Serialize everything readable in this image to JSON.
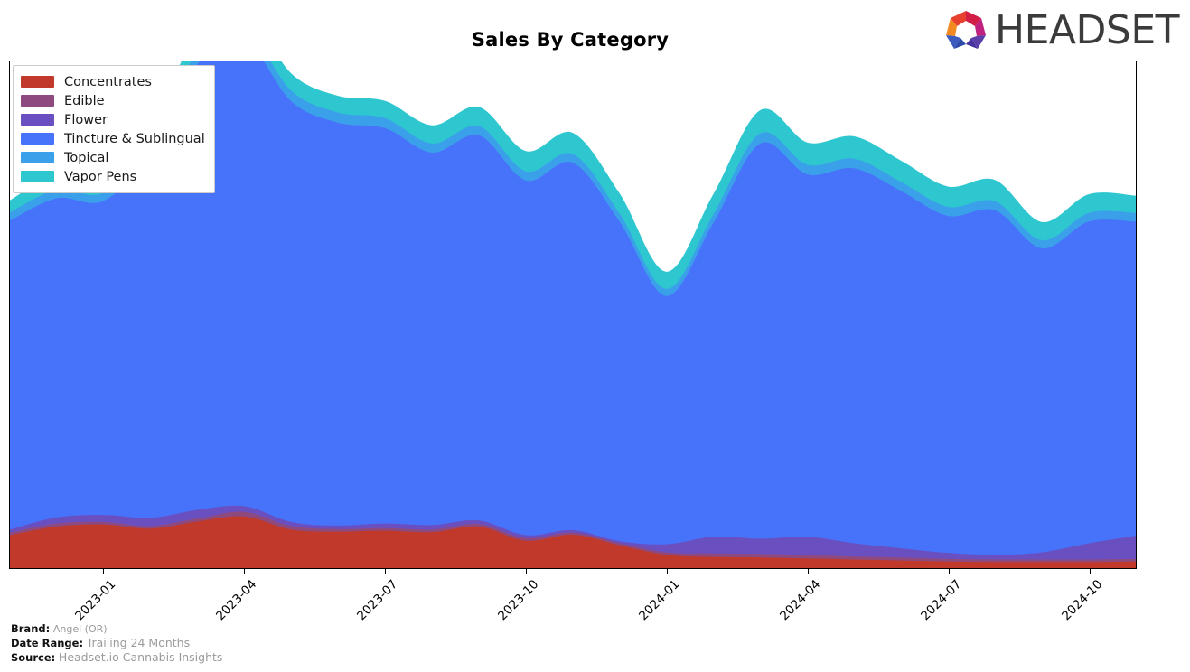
{
  "header": {
    "title": "Sales By Category",
    "logo_text": "HEADSET",
    "logo_icon": "headset-hexagon-logo"
  },
  "footer": {
    "brand_key": "Brand:",
    "brand_value": "Angel (OR)",
    "date_key": "Date Range:",
    "date_value": "Trailing 24 Months",
    "source_key": "Source:",
    "source_value": "Headset.io Cannabis Insights"
  },
  "legend": {
    "items": [
      {
        "label": "Concentrates",
        "color": "#c0392b"
      },
      {
        "label": "Edible",
        "color": "#8e4a7e"
      },
      {
        "label": "Flower",
        "color": "#6a4fc0"
      },
      {
        "label": "Tincture & Sublingual",
        "color": "#4772fa"
      },
      {
        "label": "Topical",
        "color": "#3aa0ea"
      },
      {
        "label": "Vapor Pens",
        "color": "#2ec7cf"
      }
    ]
  },
  "chart_data": {
    "type": "area",
    "stacked": true,
    "title": "Sales By Category",
    "xlabel": "",
    "ylabel": "",
    "grid": false,
    "legend_position": "upper-left",
    "axis_ticks_y_visible": false,
    "x": [
      "2022-11",
      "2022-12",
      "2023-01",
      "2023-02",
      "2023-03",
      "2023-04",
      "2023-05",
      "2023-06",
      "2023-07",
      "2023-08",
      "2023-09",
      "2023-10",
      "2023-11",
      "2023-12",
      "2024-01",
      "2024-02",
      "2024-03",
      "2024-04",
      "2024-05",
      "2024-06",
      "2024-07",
      "2024-08",
      "2024-09",
      "2024-10",
      "2024-11"
    ],
    "tick_labels": [
      "2023-01",
      "2023-04",
      "2023-07",
      "2023-10",
      "2024-01",
      "2024-04",
      "2024-07",
      "2024-10"
    ],
    "ylim": [
      0,
      100
    ],
    "series": [
      {
        "name": "Concentrates",
        "color": "#c0392b",
        "values": [
          6.5,
          8.2,
          8.6,
          7.8,
          9.2,
          10.2,
          7.6,
          7.2,
          7.4,
          7.1,
          8.2,
          5.4,
          6.6,
          4.5,
          2.6,
          2.2,
          2.1,
          1.9,
          1.7,
          1.5,
          1.3,
          1.2,
          1.2,
          1.2,
          1.3
        ]
      },
      {
        "name": "Edible",
        "color": "#8e4a7e",
        "values": [
          0.5,
          0.6,
          0.5,
          0.5,
          0.6,
          0.9,
          0.7,
          0.5,
          0.5,
          0.5,
          0.5,
          0.5,
          0.4,
          0.4,
          0.5,
          0.7,
          0.7,
          0.7,
          0.6,
          0.6,
          0.5,
          0.5,
          0.5,
          0.5,
          0.5
        ]
      },
      {
        "name": "Flower",
        "color": "#6a4fc0",
        "values": [
          0.6,
          1.2,
          1.4,
          1.6,
          1.7,
          1.1,
          0.8,
          0.7,
          0.9,
          0.9,
          0.7,
          0.6,
          0.5,
          0.4,
          1.6,
          3.3,
          3.0,
          3.6,
          2.6,
          1.8,
          1.2,
          0.9,
          1.4,
          3.2,
          4.6
        ]
      },
      {
        "name": "Tincture & Sublingual",
        "color": "#4772fa",
        "values": [
          61.0,
          63.0,
          62.0,
          72.0,
          88.0,
          92.0,
          83.0,
          79.5,
          78.0,
          73.5,
          76.0,
          70.0,
          72.5,
          63.0,
          49.0,
          62.0,
          78.0,
          71.5,
          74.0,
          70.5,
          66.5,
          68.0,
          60.0,
          63.5,
          62.0
        ]
      },
      {
        "name": "Topical",
        "color": "#3aa0ea",
        "values": [
          1.6,
          1.7,
          1.6,
          2.0,
          2.4,
          2.3,
          2.1,
          2.0,
          2.0,
          1.8,
          1.8,
          1.8,
          1.7,
          1.6,
          1.4,
          1.7,
          2.0,
          1.9,
          1.9,
          1.8,
          1.8,
          1.8,
          1.6,
          1.7,
          1.7
        ]
      },
      {
        "name": "Vapor Pens",
        "color": "#2ec7cf",
        "values": [
          2.4,
          3.0,
          2.6,
          3.2,
          3.8,
          3.6,
          3.4,
          3.3,
          3.4,
          3.6,
          3.8,
          4.0,
          4.2,
          4.0,
          3.4,
          4.0,
          4.6,
          4.4,
          4.4,
          4.2,
          4.0,
          4.2,
          3.6,
          3.7,
          3.4
        ]
      }
    ]
  }
}
